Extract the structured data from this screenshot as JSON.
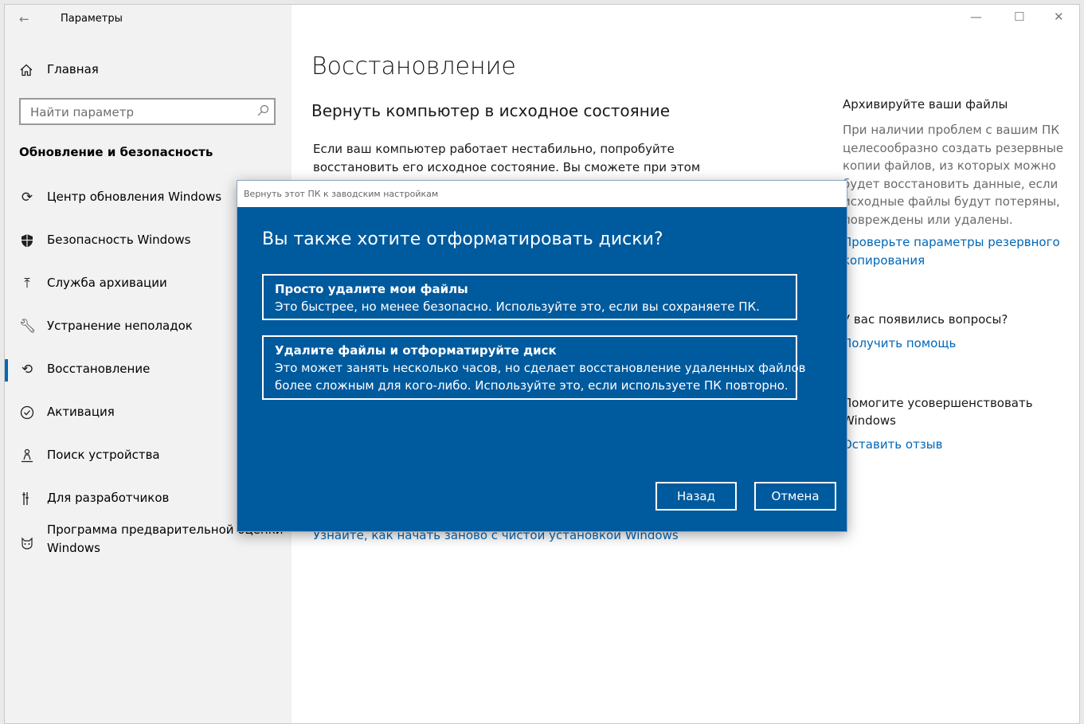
{
  "window": {
    "title": "Параметры",
    "back_icon": "arrow-left-icon",
    "controls": [
      "minimize-icon",
      "maximize-icon",
      "close-icon"
    ]
  },
  "sidebar": {
    "home": {
      "label": "Главная",
      "icon": "home-icon"
    },
    "search": {
      "placeholder": "Найти параметр",
      "icon": "search-icon"
    },
    "section_title": "Обновление и безопасность",
    "items": [
      {
        "label": "Центр обновления Windows",
        "icon": "refresh-icon"
      },
      {
        "label": "Безопасность Windows",
        "icon": "shield-icon"
      },
      {
        "label": "Служба архивации",
        "icon": "backup-arrow-icon"
      },
      {
        "label": "Устранение неполадок",
        "icon": "wrench-icon"
      },
      {
        "label": "Восстановление",
        "icon": "recovery-icon",
        "active": true
      },
      {
        "label": "Активация",
        "icon": "check-circle-icon"
      },
      {
        "label": "Поиск устройства",
        "icon": "person-location-icon"
      },
      {
        "label": "Для разработчиков",
        "icon": "developer-icon"
      },
      {
        "label": "Программа предварительной оценки Windows",
        "line1": "Программа предварительной оценки",
        "line2": "Windows",
        "icon": "insider-cat-icon"
      }
    ]
  },
  "main": {
    "title": "Восстановление",
    "subtitle": "Вернуть компьютер в исходное состояние",
    "body_line1": "Если ваш компьютер работает нестабильно, попробуйте",
    "body_line2": "восстановить его исходное состояние. Вы сможете при этом",
    "fresh_start_link": "Узнайте, как начать заново с чистой установкой Windows"
  },
  "right_panel": {
    "backup_title": "Архивируйте ваши файлы",
    "backup_text": "При наличии проблем с вашим ПК целесообразно создать резервные копии файлов, из которых можно будет восстановить данные, если исходные файлы будут потеряны, повреждены или удалены.",
    "backup_link": "Проверьте параметры резервного копирования",
    "questions_title": "У вас появились вопросы?",
    "help_link": "Получить помощь",
    "improve_title": "Помогите усовершенствовать Windows",
    "feedback_link": "Оставить отзыв"
  },
  "dialog": {
    "titlebar": "Вернуть этот ПК к заводским настройкам",
    "question": "Вы также хотите отформатировать диски?",
    "options": [
      {
        "title": "Просто удалите мои файлы",
        "desc_line1": "Это быстрее, но менее безопасно. Используйте это, если вы сохраняете ПК."
      },
      {
        "title": "Удалите файлы и отформатируйте диск",
        "desc_line1": "Это может занять несколько часов, но сделает восстановление удаленных файлов",
        "desc_line2": "более сложным для кого-либо. Используйте это, если используете ПК повторно."
      }
    ],
    "back_button": "Назад",
    "cancel_button": "Отмена"
  },
  "colors": {
    "accent": "#0067b8",
    "dialog_bg": "#005a9e",
    "sidebar_bg": "#f2f2f2"
  }
}
